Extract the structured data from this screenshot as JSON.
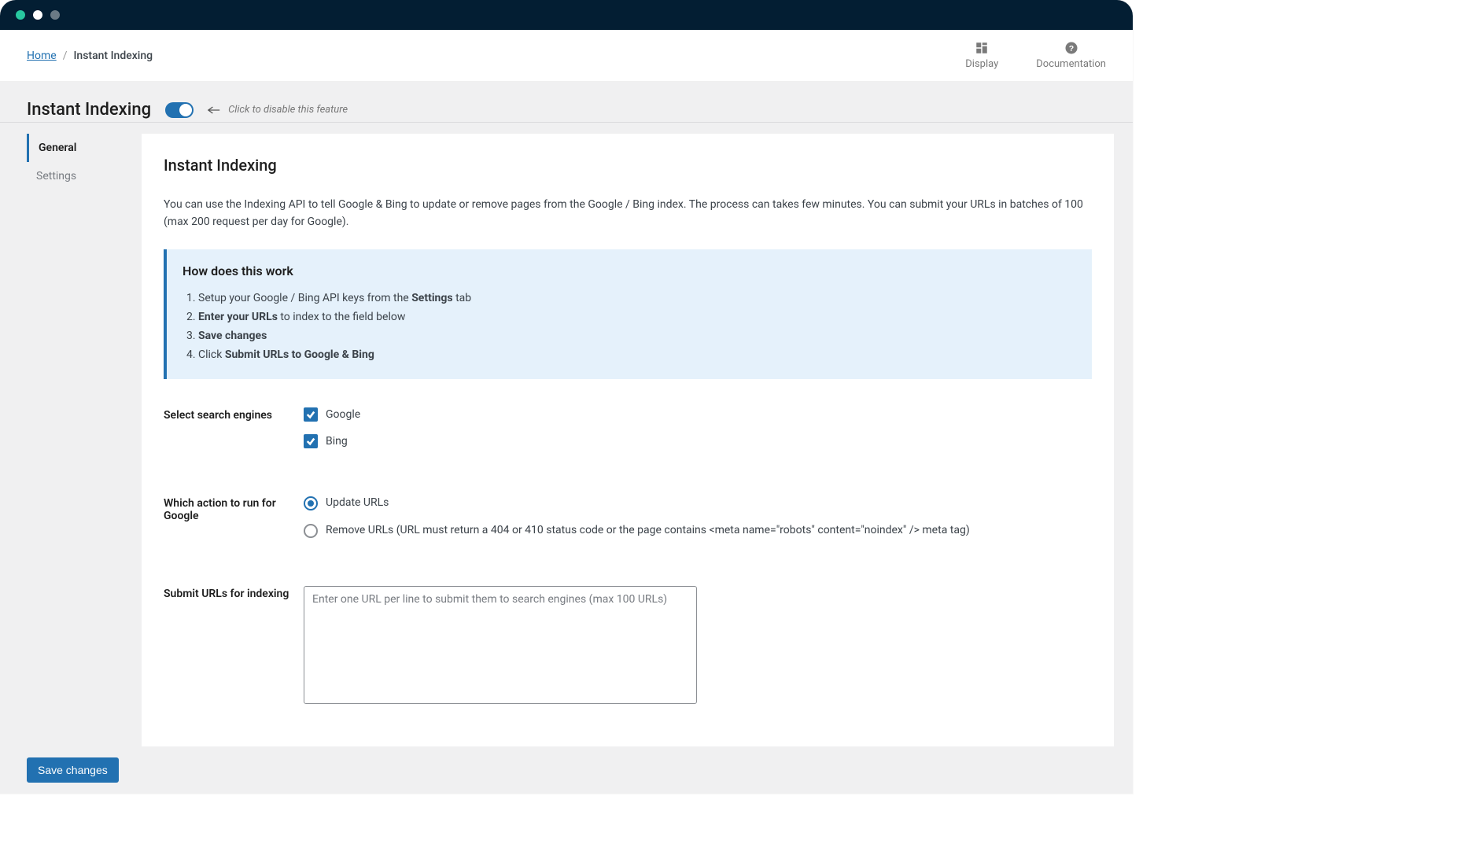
{
  "breadcrumb": {
    "home": "Home",
    "current": "Instant Indexing"
  },
  "header_actions": {
    "display": "Display",
    "documentation": "Documentation"
  },
  "page_title": "Instant Indexing",
  "toggle_hint": "Click to disable this feature",
  "sidebar": {
    "tabs": [
      {
        "label": "General",
        "active": true
      },
      {
        "label": "Settings",
        "active": false
      }
    ]
  },
  "card": {
    "title": "Instant Indexing",
    "description": "You can use the Indexing API to tell Google & Bing to update or remove pages from the Google / Bing index. The process can takes few minutes. You can submit your URLs in batches of 100 (max 200 request per day for Google).",
    "infobox": {
      "heading": "How does this work",
      "steps": {
        "s1_pre": "Setup your Google / Bing API keys from the ",
        "s1_b": "Settings",
        "s1_post": " tab",
        "s2_b": "Enter your URLs",
        "s2_post": " to index to the field below",
        "s3_b": "Save changes",
        "s4_pre": "Click ",
        "s4_b": "Submit URLs to Google & Bing"
      }
    }
  },
  "form": {
    "search_engines_label": "Select search engines",
    "engines": {
      "google": "Google",
      "bing": "Bing"
    },
    "action_label": "Which action to run for Google",
    "actions": {
      "update": "Update URLs",
      "remove": "Remove URLs (URL must return a 404 or 410 status code or the page contains <meta name=\"robots\" content=\"noindex\" /> meta tag)"
    },
    "submit_label": "Submit URLs for indexing",
    "textarea_placeholder": "Enter one URL per line to submit them to search engines (max 100 URLs)"
  },
  "save_button": "Save changes",
  "colors": {
    "accent": "#2271b1",
    "titlebar": "#031e33",
    "page_bg": "#f0f0f1",
    "infobox_bg": "#e5f1fb"
  }
}
